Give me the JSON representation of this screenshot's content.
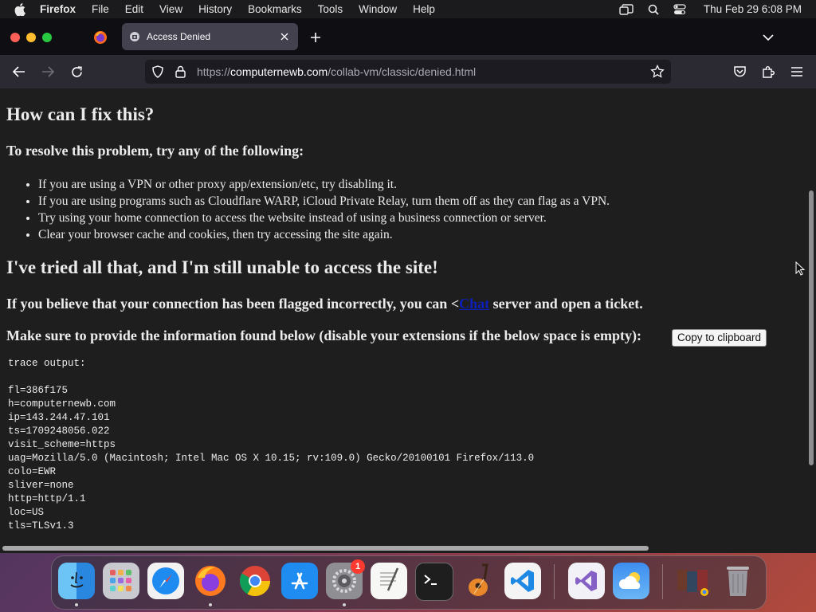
{
  "menubar": {
    "app_name": "Firefox",
    "items": [
      "File",
      "Edit",
      "View",
      "History",
      "Bookmarks",
      "Tools",
      "Window",
      "Help"
    ],
    "clock": "Thu Feb 29  6:08 PM"
  },
  "browser": {
    "tab_title": "Access Denied",
    "url_prefix": "https://",
    "url_domain": "computernewb.com",
    "url_path": "/collab-vm/classic/denied.html"
  },
  "page": {
    "heading_fix": "How can I fix this?",
    "resolve_intro": "To resolve this problem, try any of the following:",
    "fixes": [
      "If you are using a VPN or other proxy app/extension/etc, try disabling it.",
      "If you are using programs such as Cloudflare WARP, iCloud Private Relay, turn them off as they can flag as a VPN.",
      "Try using your home connection to access the website instead of using a business connection or server.",
      "Clear your browser cache and cookies, then try accessing the site again."
    ],
    "heading_tried": "I've tried all that, and I'm still unable to access the site!",
    "flagged_before": "If you believe that your connection has been flagged incorrectly, you can <",
    "flagged_link": "Chat",
    "flagged_after": " server and open a ticket.",
    "provide_info": "Make sure to provide the information found below (disable your extensions if the below space is empty):",
    "copy_button": "Copy to clipboard",
    "trace_title": "trace output:",
    "trace_lines": [
      "fl=386f175",
      "h=computernewb.com",
      "ip=143.244.47.101",
      "ts=1709248056.022",
      "visit_scheme=https",
      "uag=Mozilla/5.0 (Macintosh; Intel Mac OS X 10.15; rv:109.0) Gecko/20100101 Firefox/113.0",
      "colo=EWR",
      "sliver=none",
      "http=http/1.1",
      "loc=US",
      "tls=TLSv1.3"
    ]
  },
  "dock": {
    "apps": [
      "finder-icon",
      "launchpad-icon",
      "safari-icon",
      "firefox-icon",
      "chrome-icon",
      "app-store-icon",
      "system-settings-icon",
      "textedit-icon",
      "terminal-icon",
      "garageband-icon",
      "vscode-icon",
      "visual-studio-icon",
      "weather-icon",
      "downloads-stack-icon",
      "trash-icon"
    ],
    "settings_badge": "1"
  }
}
